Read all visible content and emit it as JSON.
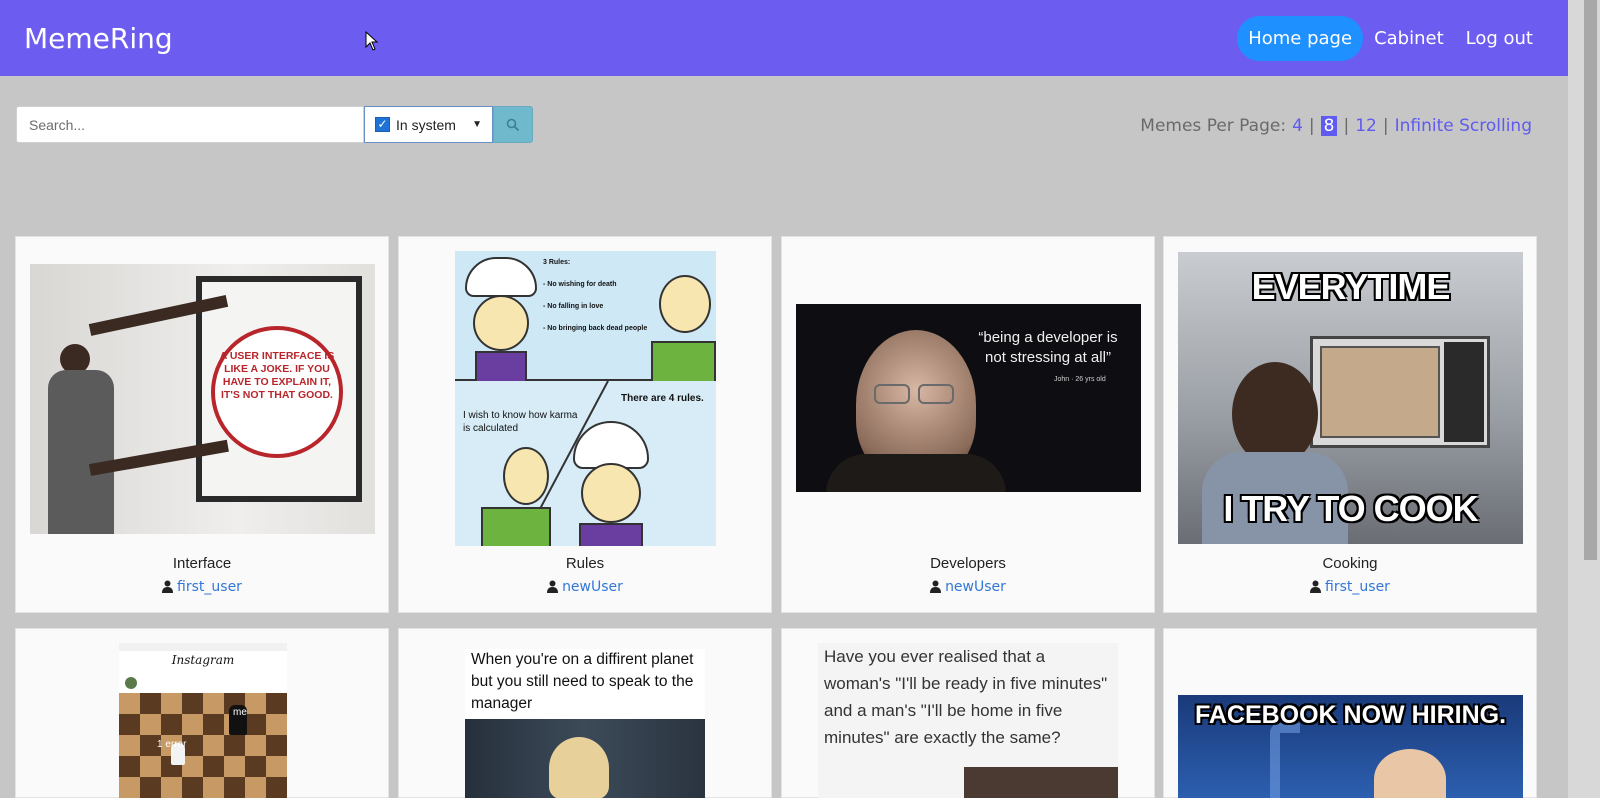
{
  "navbar": {
    "brand": "MemeRing",
    "links": [
      {
        "label": "Home page"
      },
      {
        "label": "Cabinet"
      },
      {
        "label": "Log out"
      }
    ]
  },
  "search": {
    "placeholder": "Search...",
    "value": "",
    "filter": {
      "label": "In system",
      "checked": true
    }
  },
  "per_page": {
    "label": "Memes Per Page:",
    "options": [
      "4",
      "8",
      "12",
      "Infinite Scrolling"
    ],
    "selected": "8"
  },
  "cards": [
    {
      "title": "Interface",
      "author": "first_user",
      "image_text": "A USER INTERFACE IS LIKE A JOKE. IF YOU HAVE TO EXPLAIN IT, IT'S NOT THAT GOOD."
    },
    {
      "title": "Rules",
      "author": "newUser",
      "image_text_1": "3 Rules:",
      "image_text_2": "- No wishing for death",
      "image_text_3": "- No falling in love",
      "image_text_4": "- No bringing back dead people",
      "image_text_5": "There are 4 rules.",
      "image_text_6": "I wish to know how karma is calculated"
    },
    {
      "title": "Developers",
      "author": "newUser",
      "image_text_1": "“being a developer is not stressing at all”",
      "image_text_2": "John · 26 yrs old"
    },
    {
      "title": "Cooking",
      "author": "first_user",
      "image_text_1": "EVERYTIME",
      "image_text_2": "I TRY TO COOK"
    },
    {
      "title": "",
      "author": "",
      "image_text_1": "Instagram",
      "image_text_2": "me",
      "image_text_3": "1 error"
    },
    {
      "title": "",
      "author": "",
      "image_text": "When you're on a diffirent planet but you still need to speak to the manager"
    },
    {
      "title": "",
      "author": "",
      "image_text": "Have you ever realised that a woman's \"I'll be ready in five minutes\" and a man's \"I'll be home in five minutes\" are exactly the same?"
    },
    {
      "title": "",
      "author": "",
      "image_text": "FACEBOOK NOW HIRING."
    }
  ],
  "colors": {
    "navbar": "#6c5cf0",
    "active_link": "#1e90ff",
    "accent": "#5f5af0"
  }
}
